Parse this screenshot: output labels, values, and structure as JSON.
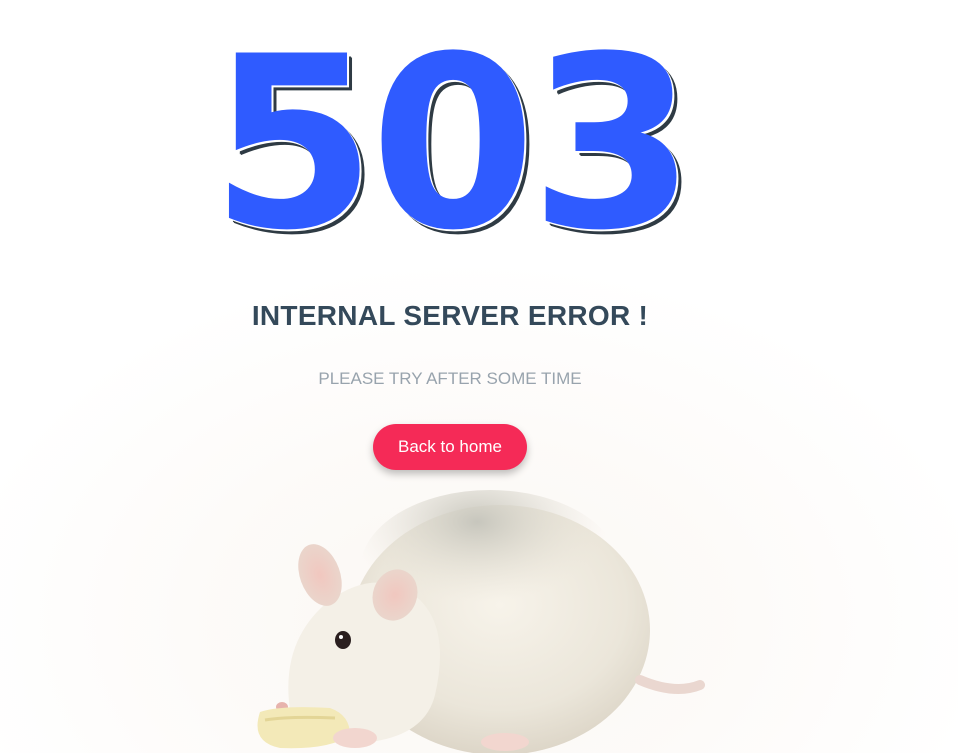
{
  "error": {
    "code": "503",
    "title": "INTERNAL SERVER ERROR !",
    "message": "PLEASE TRY AFTER SOME TIME"
  },
  "actions": {
    "home_label": "Back to home"
  },
  "illustration": {
    "icon": "rat-eating-cheese-illustration"
  },
  "colors": {
    "code": "#2f5bff",
    "code_shadow": "#2f3b44",
    "title": "#34495a",
    "message": "#98a3ad",
    "button": "#f52a57"
  }
}
